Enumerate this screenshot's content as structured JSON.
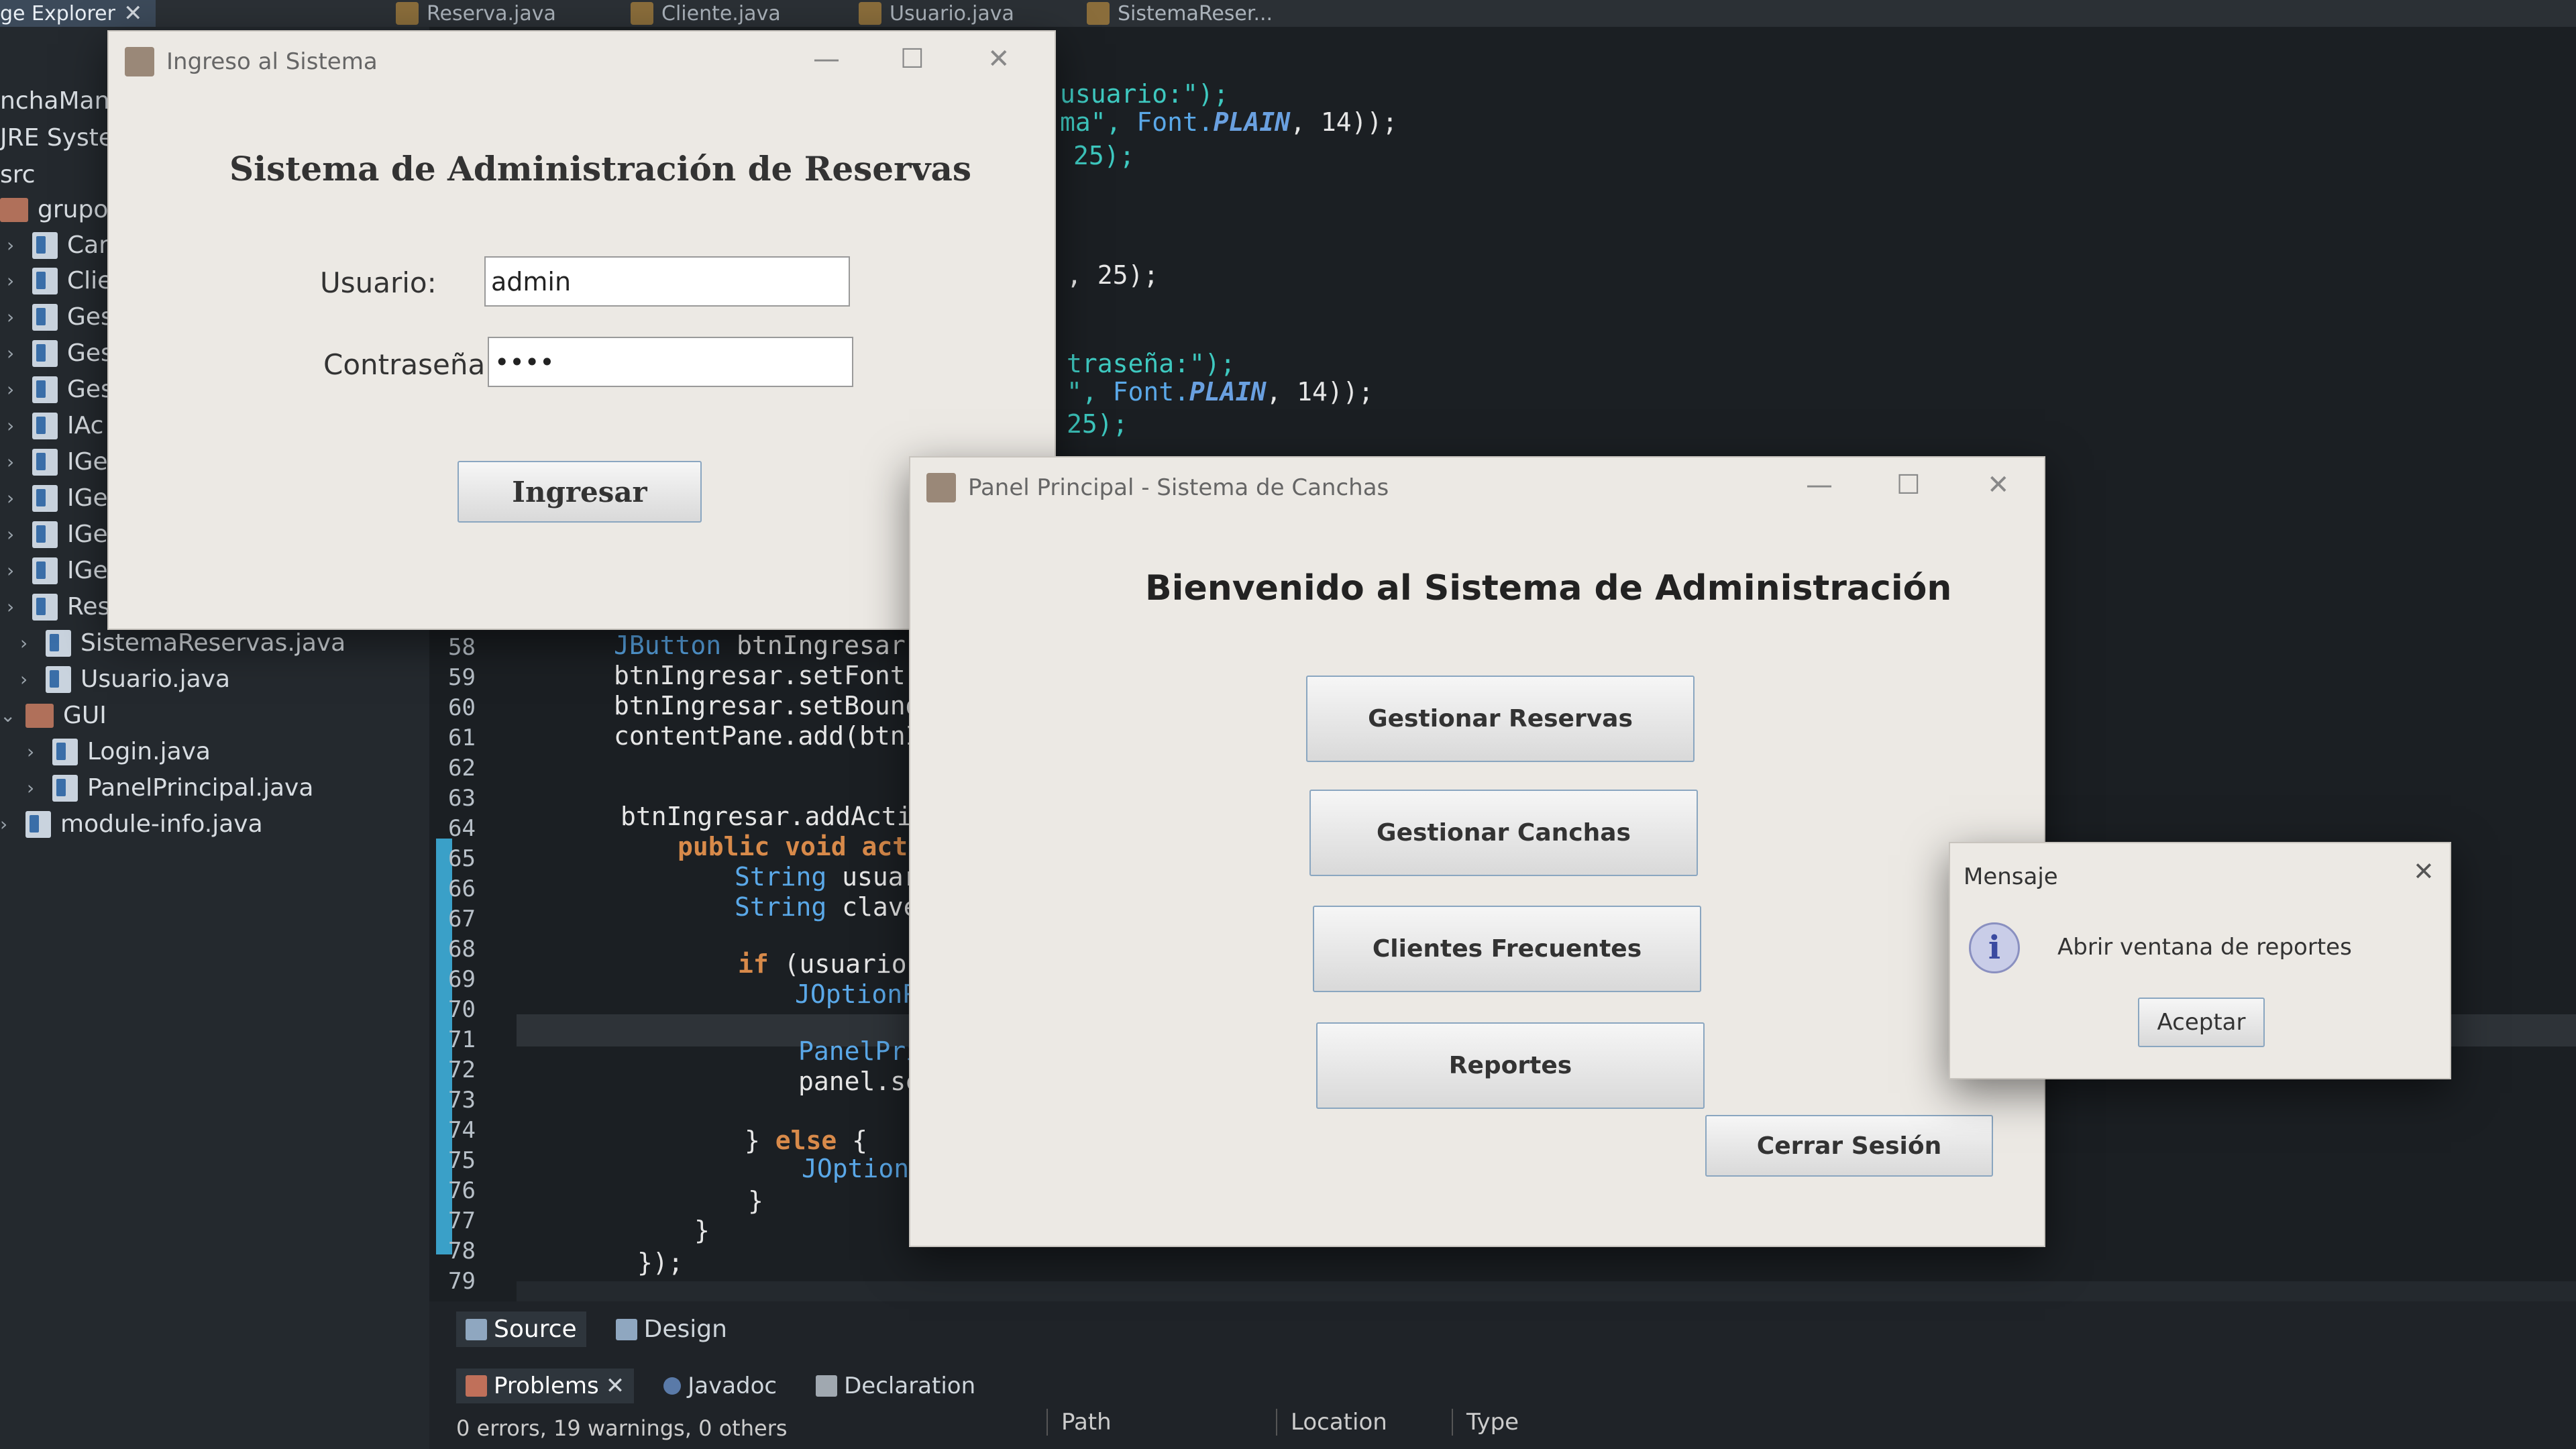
{
  "top_tabs": {
    "explorer": "ge Explorer",
    "files": [
      "Reserva.java",
      "Cliente.java",
      "Usuario.java",
      "SistemaReser..."
    ]
  },
  "explorer": {
    "items": [
      {
        "label": "nchaMan"
      },
      {
        "label": "JRE Syster"
      },
      {
        "label": "src"
      },
      {
        "label": "grupo"
      },
      {
        "label": "Car"
      },
      {
        "label": "Clie"
      },
      {
        "label": "Ges"
      },
      {
        "label": "Ges"
      },
      {
        "label": "Ges"
      },
      {
        "label": "IAc"
      },
      {
        "label": "IGe"
      },
      {
        "label": "IGe"
      },
      {
        "label": "IGe"
      },
      {
        "label": "IGe"
      },
      {
        "label": "Res"
      },
      {
        "label": "SistemaReservas.java"
      },
      {
        "label": "Usuario.java"
      },
      {
        "label": "GUI"
      },
      {
        "label": "Login.java"
      },
      {
        "label": "PanelPrincipal.java"
      },
      {
        "label": "module-info.java"
      }
    ]
  },
  "editor": {
    "line_numbers": [
      "58",
      "59",
      "60",
      "61",
      "62",
      "63",
      "64",
      "65",
      "66",
      "67",
      "68",
      "69",
      "70",
      "71",
      "72",
      "73",
      "74",
      "75",
      "76",
      "77",
      "78",
      "79"
    ],
    "code_top": {
      "l1": "usuario:\");",
      "l2a": "ma\", ",
      "l2b": "Font.",
      "l2c": "PLAIN",
      "l2d": ", 14));",
      "l3": "25);",
      "l4": ", 25);",
      "l5": "traseña:\");",
      "l6a": "\", ",
      "l6b": "Font.",
      "l6c": "PLAIN",
      "l6d": ", 14));",
      "l7": "25);"
    },
    "code": {
      "c58a": "JButton",
      "c58b": " btnIngresar =",
      "c59": "btnIngresar.setFont(",
      "c60": "btnIngresar.setBounds",
      "c61": "contentPane.add(btnIn",
      "c64": "btnIngresar.addAction",
      "c65a": "public void",
      "c65b": " actio",
      "c66a": "String",
      "c66b": " usuari",
      "c67a": "String",
      "c67b": " clave",
      "c69a": "if",
      "c69b": " (usuario.e",
      "c70": "JOptionPa",
      "c72": "PanelPrin",
      "c73": "panel.set",
      "c75a": "} ",
      "c75b": "else",
      "c75c": " {",
      "c76": "JOptionPa",
      "c77": "}",
      "c78": "}",
      "c79": "});"
    }
  },
  "bottom": {
    "source_tab": "Source",
    "design_tab": "Design",
    "problems_tab": "Problems",
    "javadoc_tab": "Javadoc",
    "declaration_tab": "Declaration",
    "status": "0 errors, 19 warnings, 0 others",
    "columns": [
      "Path",
      "Location",
      "Type"
    ]
  },
  "login_window": {
    "title": "Ingreso al Sistema",
    "heading": "Sistema de Administración de Reservas",
    "user_label": "Usuario:",
    "user_value": "admin",
    "password_label": "Contraseña:",
    "password_value": "••••",
    "submit": "Ingresar"
  },
  "main_window": {
    "title": "Panel Principal - Sistema de Canchas",
    "heading": "Bienvenido al Sistema de Administración",
    "buttons": {
      "reservas": "Gestionar Reservas",
      "canchas": "Gestionar Canchas",
      "clientes": "Clientes Frecuentes",
      "reportes": "Reportes",
      "logout": "Cerrar Sesión"
    }
  },
  "message_dialog": {
    "title": "Mensaje",
    "text": "Abrir ventana de reportes",
    "ok": "Aceptar"
  }
}
